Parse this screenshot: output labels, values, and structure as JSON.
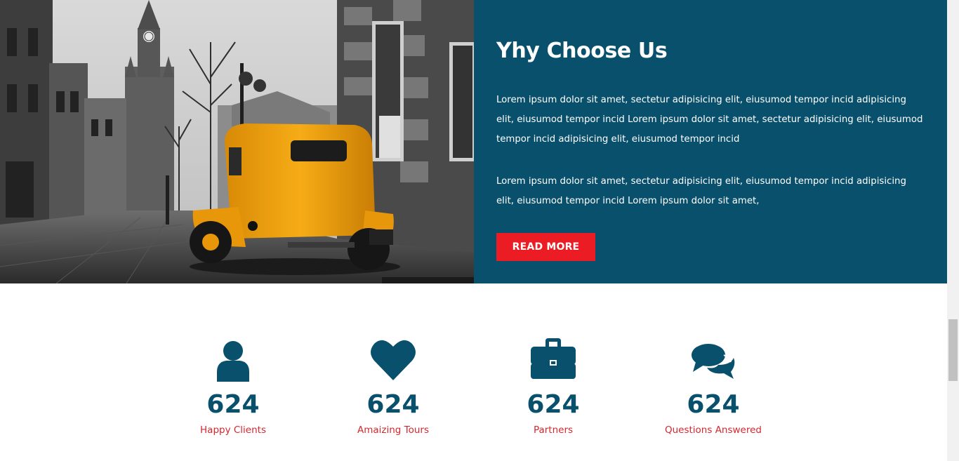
{
  "about": {
    "title": "Yhy Choose Us",
    "paragraph1": "Lorem ipsum dolor sit amet, sectetur adipisicing elit, eiusumod tempor incid adipisicing elit, eiusumod tempor incid Lorem ipsum dolor sit amet, sectetur adipisicing elit, eiusumod tempor incid adipisicing elit, eiusumod tempor incid",
    "paragraph2": "Lorem ipsum dolor sit amet, sectetur adipisicing elit, eiusumod tempor incid adipisicing elit, eiusumod tempor incid Lorem ipsum dolor sit amet,",
    "button_label": "READ MORE"
  },
  "stats": [
    {
      "icon": "user-icon",
      "value": "624",
      "label": "Happy Clients"
    },
    {
      "icon": "heart-icon",
      "value": "624",
      "label": "Amaizing Tours"
    },
    {
      "icon": "briefcase-icon",
      "value": "624",
      "label": "Partners"
    },
    {
      "icon": "comments-icon",
      "value": "624",
      "label": "Questions Answered"
    }
  ],
  "colors": {
    "brand_blue": "#09506c",
    "accent_red": "#ec1c24",
    "label_red": "#d8262e",
    "car_yellow": "#f2a612"
  }
}
